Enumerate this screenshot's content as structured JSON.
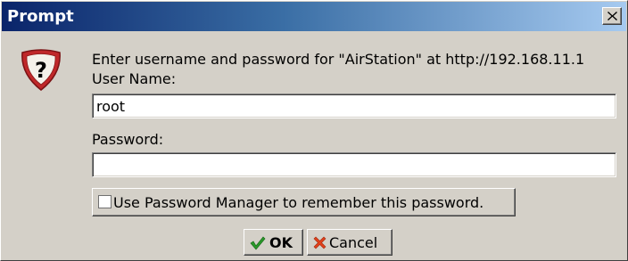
{
  "window": {
    "title": "Prompt",
    "close_glyph": "×"
  },
  "dialog": {
    "icon": "question-icon",
    "message": "Enter username and password for \"AirStation\" at http://192.168.11.1",
    "username_label": "User Name:",
    "username_value": "root",
    "password_label": "Password:",
    "password_value": "",
    "remember_label": "Use Password Manager to remember this password.",
    "remember_checked": false
  },
  "buttons": {
    "ok_label": "OK",
    "cancel_label": "Cancel"
  },
  "colors": {
    "title_gradient_start": "#0a246a",
    "title_gradient_end": "#a6caf0",
    "dialog_bg": "#d4d0c8",
    "icon_red": "#c0282a",
    "ok_check": "#2a9a2a",
    "cancel_x": "#e0401a"
  }
}
